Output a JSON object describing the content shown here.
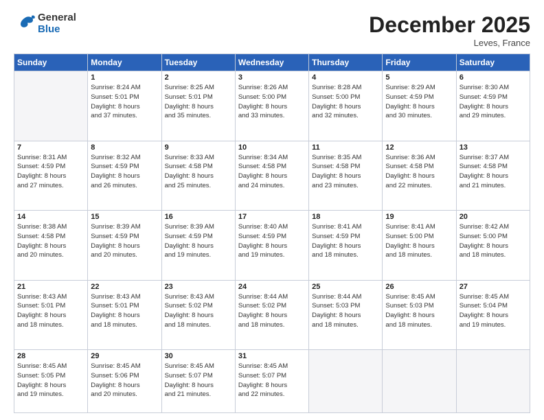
{
  "header": {
    "logo_general": "General",
    "logo_blue": "Blue",
    "month_title": "December 2025",
    "location": "Leves, France"
  },
  "days_of_week": [
    "Sunday",
    "Monday",
    "Tuesday",
    "Wednesday",
    "Thursday",
    "Friday",
    "Saturday"
  ],
  "weeks": [
    [
      {
        "num": "",
        "detail": ""
      },
      {
        "num": "1",
        "detail": "Sunrise: 8:24 AM\nSunset: 5:01 PM\nDaylight: 8 hours\nand 37 minutes."
      },
      {
        "num": "2",
        "detail": "Sunrise: 8:25 AM\nSunset: 5:01 PM\nDaylight: 8 hours\nand 35 minutes."
      },
      {
        "num": "3",
        "detail": "Sunrise: 8:26 AM\nSunset: 5:00 PM\nDaylight: 8 hours\nand 33 minutes."
      },
      {
        "num": "4",
        "detail": "Sunrise: 8:28 AM\nSunset: 5:00 PM\nDaylight: 8 hours\nand 32 minutes."
      },
      {
        "num": "5",
        "detail": "Sunrise: 8:29 AM\nSunset: 4:59 PM\nDaylight: 8 hours\nand 30 minutes."
      },
      {
        "num": "6",
        "detail": "Sunrise: 8:30 AM\nSunset: 4:59 PM\nDaylight: 8 hours\nand 29 minutes."
      }
    ],
    [
      {
        "num": "7",
        "detail": "Sunrise: 8:31 AM\nSunset: 4:59 PM\nDaylight: 8 hours\nand 27 minutes."
      },
      {
        "num": "8",
        "detail": "Sunrise: 8:32 AM\nSunset: 4:59 PM\nDaylight: 8 hours\nand 26 minutes."
      },
      {
        "num": "9",
        "detail": "Sunrise: 8:33 AM\nSunset: 4:58 PM\nDaylight: 8 hours\nand 25 minutes."
      },
      {
        "num": "10",
        "detail": "Sunrise: 8:34 AM\nSunset: 4:58 PM\nDaylight: 8 hours\nand 24 minutes."
      },
      {
        "num": "11",
        "detail": "Sunrise: 8:35 AM\nSunset: 4:58 PM\nDaylight: 8 hours\nand 23 minutes."
      },
      {
        "num": "12",
        "detail": "Sunrise: 8:36 AM\nSunset: 4:58 PM\nDaylight: 8 hours\nand 22 minutes."
      },
      {
        "num": "13",
        "detail": "Sunrise: 8:37 AM\nSunset: 4:58 PM\nDaylight: 8 hours\nand 21 minutes."
      }
    ],
    [
      {
        "num": "14",
        "detail": "Sunrise: 8:38 AM\nSunset: 4:58 PM\nDaylight: 8 hours\nand 20 minutes."
      },
      {
        "num": "15",
        "detail": "Sunrise: 8:39 AM\nSunset: 4:59 PM\nDaylight: 8 hours\nand 20 minutes."
      },
      {
        "num": "16",
        "detail": "Sunrise: 8:39 AM\nSunset: 4:59 PM\nDaylight: 8 hours\nand 19 minutes."
      },
      {
        "num": "17",
        "detail": "Sunrise: 8:40 AM\nSunset: 4:59 PM\nDaylight: 8 hours\nand 19 minutes."
      },
      {
        "num": "18",
        "detail": "Sunrise: 8:41 AM\nSunset: 4:59 PM\nDaylight: 8 hours\nand 18 minutes."
      },
      {
        "num": "19",
        "detail": "Sunrise: 8:41 AM\nSunset: 5:00 PM\nDaylight: 8 hours\nand 18 minutes."
      },
      {
        "num": "20",
        "detail": "Sunrise: 8:42 AM\nSunset: 5:00 PM\nDaylight: 8 hours\nand 18 minutes."
      }
    ],
    [
      {
        "num": "21",
        "detail": "Sunrise: 8:43 AM\nSunset: 5:01 PM\nDaylight: 8 hours\nand 18 minutes."
      },
      {
        "num": "22",
        "detail": "Sunrise: 8:43 AM\nSunset: 5:01 PM\nDaylight: 8 hours\nand 18 minutes."
      },
      {
        "num": "23",
        "detail": "Sunrise: 8:43 AM\nSunset: 5:02 PM\nDaylight: 8 hours\nand 18 minutes."
      },
      {
        "num": "24",
        "detail": "Sunrise: 8:44 AM\nSunset: 5:02 PM\nDaylight: 8 hours\nand 18 minutes."
      },
      {
        "num": "25",
        "detail": "Sunrise: 8:44 AM\nSunset: 5:03 PM\nDaylight: 8 hours\nand 18 minutes."
      },
      {
        "num": "26",
        "detail": "Sunrise: 8:45 AM\nSunset: 5:03 PM\nDaylight: 8 hours\nand 18 minutes."
      },
      {
        "num": "27",
        "detail": "Sunrise: 8:45 AM\nSunset: 5:04 PM\nDaylight: 8 hours\nand 19 minutes."
      }
    ],
    [
      {
        "num": "28",
        "detail": "Sunrise: 8:45 AM\nSunset: 5:05 PM\nDaylight: 8 hours\nand 19 minutes."
      },
      {
        "num": "29",
        "detail": "Sunrise: 8:45 AM\nSunset: 5:06 PM\nDaylight: 8 hours\nand 20 minutes."
      },
      {
        "num": "30",
        "detail": "Sunrise: 8:45 AM\nSunset: 5:07 PM\nDaylight: 8 hours\nand 21 minutes."
      },
      {
        "num": "31",
        "detail": "Sunrise: 8:45 AM\nSunset: 5:07 PM\nDaylight: 8 hours\nand 22 minutes."
      },
      {
        "num": "",
        "detail": ""
      },
      {
        "num": "",
        "detail": ""
      },
      {
        "num": "",
        "detail": ""
      }
    ]
  ]
}
